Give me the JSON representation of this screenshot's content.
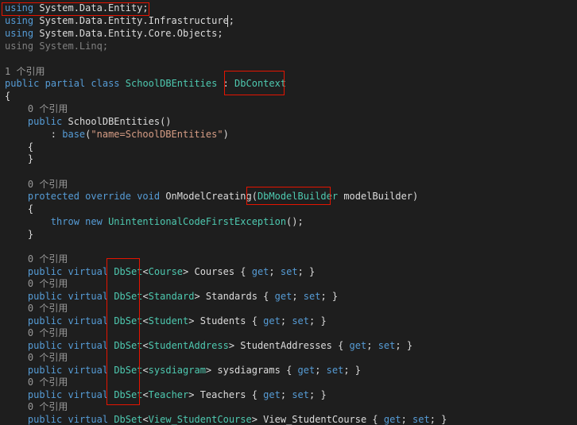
{
  "editor": {
    "language": "C#",
    "colors": {
      "background": "#1e1e1e",
      "keyword": "#569cd6",
      "type": "#4ec9b0",
      "string": "#d69d85",
      "plain": "#dcdcdc",
      "codelens": "#999999",
      "highlight_box": "#e51400"
    },
    "lines": [
      [
        {
          "t": "using",
          "c": "kw"
        },
        {
          "t": " System.Data.Entity;",
          "c": "plain"
        }
      ],
      [
        {
          "t": "using",
          "c": "kw"
        },
        {
          "t": " System.Data.Entity.Infrastructure;",
          "c": "plain"
        }
      ],
      [
        {
          "t": "using",
          "c": "kw"
        },
        {
          "t": " System.Data.Entity.Core.Objects;",
          "c": "plain"
        }
      ],
      [
        {
          "t": "using",
          "c": "dim"
        },
        {
          "t": " System.Linq;",
          "c": "dim"
        }
      ],
      [],
      [
        {
          "t": "1 个引用",
          "c": "meta"
        }
      ],
      [
        {
          "t": "public",
          "c": "kw"
        },
        {
          "t": " ",
          "c": "plain"
        },
        {
          "t": "partial",
          "c": "kw"
        },
        {
          "t": " ",
          "c": "plain"
        },
        {
          "t": "class",
          "c": "kw"
        },
        {
          "t": " ",
          "c": "plain"
        },
        {
          "t": "SchoolDBEntities",
          "c": "type"
        },
        {
          "t": " : ",
          "c": "plain"
        },
        {
          "t": "DbContext",
          "c": "type"
        }
      ],
      [
        {
          "t": "{",
          "c": "plain"
        }
      ],
      [
        {
          "t": "    0 个引用",
          "c": "meta"
        }
      ],
      [
        {
          "t": "    ",
          "c": "plain"
        },
        {
          "t": "public",
          "c": "kw"
        },
        {
          "t": " SchoolDBEntities()",
          "c": "plain"
        }
      ],
      [
        {
          "t": "        : ",
          "c": "plain"
        },
        {
          "t": "base",
          "c": "kw"
        },
        {
          "t": "(",
          "c": "plain"
        },
        {
          "t": "\"name=SchoolDBEntities\"",
          "c": "str"
        },
        {
          "t": ")",
          "c": "plain"
        }
      ],
      [
        {
          "t": "    {",
          "c": "plain"
        }
      ],
      [
        {
          "t": "    }",
          "c": "plain"
        }
      ],
      [],
      [
        {
          "t": "    0 个引用",
          "c": "meta"
        }
      ],
      [
        {
          "t": "    ",
          "c": "plain"
        },
        {
          "t": "protected",
          "c": "kw"
        },
        {
          "t": " ",
          "c": "plain"
        },
        {
          "t": "override",
          "c": "kw"
        },
        {
          "t": " ",
          "c": "plain"
        },
        {
          "t": "void",
          "c": "kw"
        },
        {
          "t": " OnModelCreating(",
          "c": "plain"
        },
        {
          "t": "DbModelBuilder",
          "c": "type"
        },
        {
          "t": " modelBuilder)",
          "c": "plain"
        }
      ],
      [
        {
          "t": "    {",
          "c": "plain"
        }
      ],
      [
        {
          "t": "        ",
          "c": "plain"
        },
        {
          "t": "throw",
          "c": "kw"
        },
        {
          "t": " ",
          "c": "plain"
        },
        {
          "t": "new",
          "c": "kw"
        },
        {
          "t": " ",
          "c": "plain"
        },
        {
          "t": "UnintentionalCodeFirstException",
          "c": "type"
        },
        {
          "t": "();",
          "c": "plain"
        }
      ],
      [
        {
          "t": "    }",
          "c": "plain"
        }
      ],
      [],
      [
        {
          "t": "    0 个引用",
          "c": "meta"
        }
      ],
      [
        {
          "t": "    ",
          "c": "plain"
        },
        {
          "t": "public",
          "c": "kw"
        },
        {
          "t": " ",
          "c": "plain"
        },
        {
          "t": "virtual",
          "c": "kw"
        },
        {
          "t": " ",
          "c": "plain"
        },
        {
          "t": "DbSet",
          "c": "type"
        },
        {
          "t": "<",
          "c": "plain"
        },
        {
          "t": "Course",
          "c": "type"
        },
        {
          "t": "> Courses { ",
          "c": "plain"
        },
        {
          "t": "get",
          "c": "kw"
        },
        {
          "t": "; ",
          "c": "plain"
        },
        {
          "t": "set",
          "c": "kw"
        },
        {
          "t": "; }",
          "c": "plain"
        }
      ],
      [
        {
          "t": "    0 个引用",
          "c": "meta"
        }
      ],
      [
        {
          "t": "    ",
          "c": "plain"
        },
        {
          "t": "public",
          "c": "kw"
        },
        {
          "t": " ",
          "c": "plain"
        },
        {
          "t": "virtual",
          "c": "kw"
        },
        {
          "t": " ",
          "c": "plain"
        },
        {
          "t": "DbSet",
          "c": "type"
        },
        {
          "t": "<",
          "c": "plain"
        },
        {
          "t": "Standard",
          "c": "type"
        },
        {
          "t": "> Standards { ",
          "c": "plain"
        },
        {
          "t": "get",
          "c": "kw"
        },
        {
          "t": "; ",
          "c": "plain"
        },
        {
          "t": "set",
          "c": "kw"
        },
        {
          "t": "; }",
          "c": "plain"
        }
      ],
      [
        {
          "t": "    0 个引用",
          "c": "meta"
        }
      ],
      [
        {
          "t": "    ",
          "c": "plain"
        },
        {
          "t": "public",
          "c": "kw"
        },
        {
          "t": " ",
          "c": "plain"
        },
        {
          "t": "virtual",
          "c": "kw"
        },
        {
          "t": " ",
          "c": "plain"
        },
        {
          "t": "DbSet",
          "c": "type"
        },
        {
          "t": "<",
          "c": "plain"
        },
        {
          "t": "Student",
          "c": "type"
        },
        {
          "t": "> Students { ",
          "c": "plain"
        },
        {
          "t": "get",
          "c": "kw"
        },
        {
          "t": "; ",
          "c": "plain"
        },
        {
          "t": "set",
          "c": "kw"
        },
        {
          "t": "; }",
          "c": "plain"
        }
      ],
      [
        {
          "t": "    0 个引用",
          "c": "meta"
        }
      ],
      [
        {
          "t": "    ",
          "c": "plain"
        },
        {
          "t": "public",
          "c": "kw"
        },
        {
          "t": " ",
          "c": "plain"
        },
        {
          "t": "virtual",
          "c": "kw"
        },
        {
          "t": " ",
          "c": "plain"
        },
        {
          "t": "DbSet",
          "c": "type"
        },
        {
          "t": "<",
          "c": "plain"
        },
        {
          "t": "StudentAddress",
          "c": "type"
        },
        {
          "t": "> StudentAddresses { ",
          "c": "plain"
        },
        {
          "t": "get",
          "c": "kw"
        },
        {
          "t": "; ",
          "c": "plain"
        },
        {
          "t": "set",
          "c": "kw"
        },
        {
          "t": "; }",
          "c": "plain"
        }
      ],
      [
        {
          "t": "    0 个引用",
          "c": "meta"
        }
      ],
      [
        {
          "t": "    ",
          "c": "plain"
        },
        {
          "t": "public",
          "c": "kw"
        },
        {
          "t": " ",
          "c": "plain"
        },
        {
          "t": "virtual",
          "c": "kw"
        },
        {
          "t": " ",
          "c": "plain"
        },
        {
          "t": "DbSet",
          "c": "type"
        },
        {
          "t": "<",
          "c": "plain"
        },
        {
          "t": "sysdiagram",
          "c": "type"
        },
        {
          "t": "> sysdiagrams { ",
          "c": "plain"
        },
        {
          "t": "get",
          "c": "kw"
        },
        {
          "t": "; ",
          "c": "plain"
        },
        {
          "t": "set",
          "c": "kw"
        },
        {
          "t": "; }",
          "c": "plain"
        }
      ],
      [
        {
          "t": "    0 个引用",
          "c": "meta"
        }
      ],
      [
        {
          "t": "    ",
          "c": "plain"
        },
        {
          "t": "public",
          "c": "kw"
        },
        {
          "t": " ",
          "c": "plain"
        },
        {
          "t": "virtual",
          "c": "kw"
        },
        {
          "t": " ",
          "c": "plain"
        },
        {
          "t": "DbSet",
          "c": "type"
        },
        {
          "t": "<",
          "c": "plain"
        },
        {
          "t": "Teacher",
          "c": "type"
        },
        {
          "t": "> Teachers { ",
          "c": "plain"
        },
        {
          "t": "get",
          "c": "kw"
        },
        {
          "t": "; ",
          "c": "plain"
        },
        {
          "t": "set",
          "c": "kw"
        },
        {
          "t": "; }",
          "c": "plain"
        }
      ],
      [
        {
          "t": "    0 个引用",
          "c": "meta"
        }
      ],
      [
        {
          "t": "    ",
          "c": "plain"
        },
        {
          "t": "public",
          "c": "kw"
        },
        {
          "t": " ",
          "c": "plain"
        },
        {
          "t": "virtual",
          "c": "kw"
        },
        {
          "t": " ",
          "c": "plain"
        },
        {
          "t": "DbSet",
          "c": "type"
        },
        {
          "t": "<",
          "c": "plain"
        },
        {
          "t": "View_StudentCourse",
          "c": "type"
        },
        {
          "t": "> View_StudentCourse { ",
          "c": "plain"
        },
        {
          "t": "get",
          "c": "kw"
        },
        {
          "t": "; ",
          "c": "plain"
        },
        {
          "t": "set",
          "c": "kw"
        },
        {
          "t": "; }",
          "c": "plain"
        }
      ]
    ]
  }
}
